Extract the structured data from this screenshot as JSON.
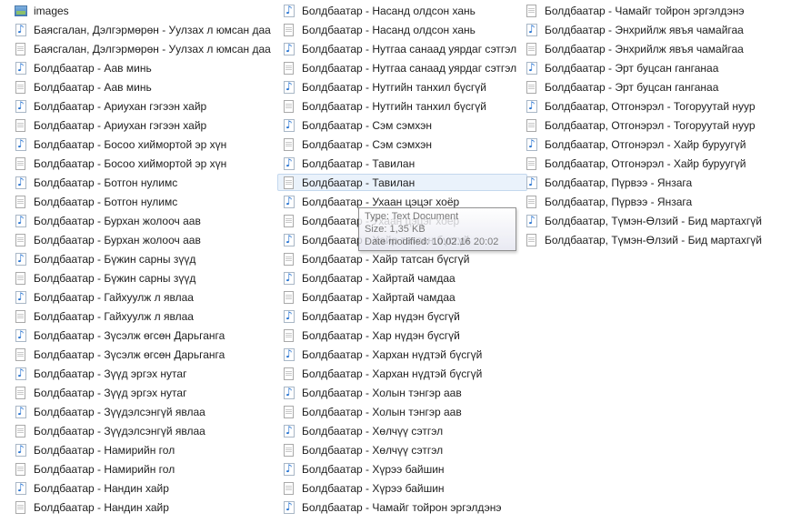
{
  "columns": [
    [
      {
        "label": "images",
        "icon": "image-folder-icon"
      },
      {
        "label": "Баясгалан, Дэлгэрмөрөн - Уулзах л юмсан даа",
        "icon": "audio-file-icon"
      },
      {
        "label": "Баясгалан, Дэлгэрмөрөн - Уулзах л юмсан даа",
        "icon": "text-file-icon"
      },
      {
        "label": "Болдбаатар - Аав минь",
        "icon": "audio-file-icon"
      },
      {
        "label": "Болдбаатар - Аав минь",
        "icon": "text-file-icon"
      },
      {
        "label": "Болдбаатар - Ариухан гэгээн хайр",
        "icon": "audio-file-icon"
      },
      {
        "label": "Болдбаатар - Ариухан гэгээн хайр",
        "icon": "text-file-icon"
      },
      {
        "label": "Болдбаатар - Босоо хиймортой эр хүн",
        "icon": "audio-file-icon"
      },
      {
        "label": "Болдбаатар - Босоо хиймортой эр хүн",
        "icon": "text-file-icon"
      },
      {
        "label": "Болдбаатар - Ботгон нулимс",
        "icon": "audio-file-icon"
      },
      {
        "label": "Болдбаатар - Ботгон нулимс",
        "icon": "text-file-icon"
      },
      {
        "label": "Болдбаатар - Бурхан жолооч аав",
        "icon": "audio-file-icon"
      },
      {
        "label": "Болдбаатар - Бурхан жолооч аав",
        "icon": "text-file-icon"
      },
      {
        "label": "Болдбаатар - Бүжин сарны зүүд",
        "icon": "audio-file-icon"
      },
      {
        "label": "Болдбаатар - Бүжин сарны зүүд",
        "icon": "text-file-icon"
      },
      {
        "label": "Болдбаатар - Гайхуулж л явлаа",
        "icon": "audio-file-icon"
      },
      {
        "label": "Болдбаатар - Гайхуулж л явлаа",
        "icon": "text-file-icon"
      },
      {
        "label": "Болдбаатар - Зүсэлж өгсөн Дарьганга",
        "icon": "audio-file-icon"
      },
      {
        "label": "Болдбаатар - Зүсэлж өгсөн Дарьганга",
        "icon": "text-file-icon"
      },
      {
        "label": "Болдбаатар - Зүүд эргэх нутаг",
        "icon": "audio-file-icon"
      },
      {
        "label": "Болдбаатар - Зүүд эргэх нутаг",
        "icon": "text-file-icon"
      },
      {
        "label": "Болдбаатар - Зүүдэлсэнгүй явлаа",
        "icon": "audio-file-icon"
      },
      {
        "label": "Болдбаатар - Зүүдэлсэнгүй явлаа",
        "icon": "text-file-icon"
      },
      {
        "label": "Болдбаатар - Намирийн гол",
        "icon": "audio-file-icon"
      },
      {
        "label": "Болдбаатар - Намирийн гол",
        "icon": "text-file-icon"
      },
      {
        "label": "Болдбаатар - Нандин хайр",
        "icon": "audio-file-icon"
      },
      {
        "label": "Болдбаатар - Нандин хайр",
        "icon": "text-file-icon"
      }
    ],
    [
      {
        "label": "Болдбаатар - Насанд олдсон хань",
        "icon": "audio-file-icon"
      },
      {
        "label": "Болдбаатар - Насанд олдсон хань",
        "icon": "text-file-icon"
      },
      {
        "label": "Болдбаатар - Нутгаа санаад уярдаг сэтгэл",
        "icon": "audio-file-icon"
      },
      {
        "label": "Болдбаатар - Нутгаа санаад уярдаг сэтгэл",
        "icon": "text-file-icon"
      },
      {
        "label": "Болдбаатар - Нутгийн танхил бүсгүй",
        "icon": "audio-file-icon"
      },
      {
        "label": "Болдбаатар - Нутгийн танхил бүсгүй",
        "icon": "text-file-icon"
      },
      {
        "label": "Болдбаатар - Сэм сэмхэн",
        "icon": "audio-file-icon"
      },
      {
        "label": "Болдбаатар - Сэм сэмхэн",
        "icon": "text-file-icon"
      },
      {
        "label": "Болдбаатар - Тавилан",
        "icon": "audio-file-icon"
      },
      {
        "label": "Болдбаатар - Тавилан",
        "icon": "text-file-icon",
        "hover": true
      },
      {
        "label": "Болдбаатар - Ухаан цэцэг хоёр",
        "icon": "audio-file-icon"
      },
      {
        "label": "Болдбаатар - Ухаан цэцэг хоёр",
        "icon": "text-file-icon"
      },
      {
        "label": "Болдбаатар - Хайр татсан бүсгүй",
        "icon": "audio-file-icon"
      },
      {
        "label": "Болдбаатар - Хайр татсан бүсгүй",
        "icon": "text-file-icon"
      },
      {
        "label": "Болдбаатар - Хайртай чамдаа",
        "icon": "audio-file-icon"
      },
      {
        "label": "Болдбаатар - Хайртай чамдаа",
        "icon": "text-file-icon"
      },
      {
        "label": "Болдбаатар - Хар нүдэн бүсгүй",
        "icon": "audio-file-icon"
      },
      {
        "label": "Болдбаатар - Хар нүдэн бүсгүй",
        "icon": "text-file-icon"
      },
      {
        "label": "Болдбаатар - Хархан нүдтэй бүсгүй",
        "icon": "audio-file-icon"
      },
      {
        "label": "Болдбаатар - Хархан нүдтэй бүсгүй",
        "icon": "text-file-icon"
      },
      {
        "label": "Болдбаатар - Холын тэнгэр аав",
        "icon": "audio-file-icon"
      },
      {
        "label": "Болдбаатар - Холын тэнгэр аав",
        "icon": "text-file-icon"
      },
      {
        "label": "Болдбаатар - Хөлчүү сэтгэл",
        "icon": "audio-file-icon"
      },
      {
        "label": "Болдбаатар - Хөлчүү сэтгэл",
        "icon": "text-file-icon"
      },
      {
        "label": "Болдбаатар - Хүрээ байшин",
        "icon": "audio-file-icon"
      },
      {
        "label": "Болдбаатар - Хүрээ байшин",
        "icon": "text-file-icon"
      },
      {
        "label": "Болдбаатар - Чамайг тойрон эргэлдэнэ",
        "icon": "audio-file-icon"
      }
    ],
    [
      {
        "label": "Болдбаатар - Чамайг тойрон эргэлдэнэ",
        "icon": "text-file-icon"
      },
      {
        "label": "Болдбаатар - Энхрийлж явъя чамайгаа",
        "icon": "audio-file-icon"
      },
      {
        "label": "Болдбаатар - Энхрийлж явъя чамайгаа",
        "icon": "text-file-icon"
      },
      {
        "label": "Болдбаатар - Эрт буцсан ганганаа",
        "icon": "audio-file-icon"
      },
      {
        "label": "Болдбаатар - Эрт буцсан ганганаа",
        "icon": "text-file-icon"
      },
      {
        "label": "Болдбаатар, Отгонэрэл - Тогоруутай нуур",
        "icon": "audio-file-icon"
      },
      {
        "label": "Болдбаатар, Отгонэрэл - Тогоруутай нуур",
        "icon": "text-file-icon"
      },
      {
        "label": "Болдбаатар, Отгонэрэл - Хайр буруугүй",
        "icon": "audio-file-icon"
      },
      {
        "label": "Болдбаатар, Отгонэрэл - Хайр буруугүй",
        "icon": "text-file-icon"
      },
      {
        "label": "Болдбаатар, Пүрвээ - Янзага",
        "icon": "audio-file-icon"
      },
      {
        "label": "Болдбаатар, Пүрвээ - Янзага",
        "icon": "text-file-icon"
      },
      {
        "label": "Болдбаатар, Түмэн-Өлзий - Бид мартахгүй",
        "icon": "audio-file-icon"
      },
      {
        "label": "Болдбаатар, Түмэн-Өлзий - Бид мартахгүй",
        "icon": "text-file-icon"
      }
    ]
  ],
  "tooltip": {
    "type_line": "Type: Text Document",
    "size_line": "Size: 1,35 KB",
    "date_line": "Date modified: 10.02.16 20:02"
  }
}
